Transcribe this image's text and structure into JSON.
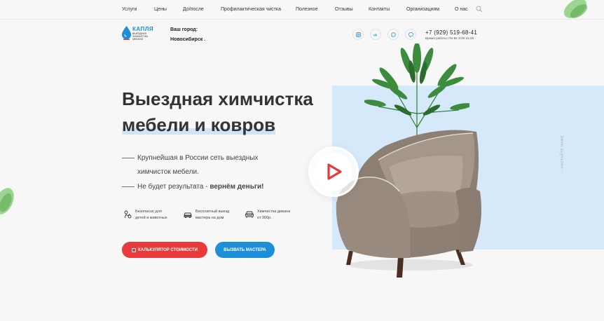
{
  "nav": {
    "items": [
      "Услуги",
      "Цены",
      "До/после",
      "Профилактическая чистка",
      "Полезное",
      "Отзывы",
      "Контакты",
      "Организациям",
      "О нас"
    ]
  },
  "logo": {
    "brand": "КАПЛЯ",
    "subtitle_lines": [
      "ВЫЕЗДНАЯ",
      "ХИМЧИСТКА",
      "МЕБЕЛИ"
    ]
  },
  "city": {
    "label": "Ваш город:",
    "value": "Новосибирск ."
  },
  "social": [
    "instagram-icon",
    "vk-icon",
    "whatsapp-icon",
    "viber-icon"
  ],
  "contacts": {
    "phone": "+7 (929) 519-68-41",
    "hours": "Время работы: Пн-Вс 9:00-21:00"
  },
  "hero": {
    "title_line1": "Выездная химчистка",
    "title_line2": "мебели и ковров",
    "lead_line1": "Крупнейшая в России сеть выездных",
    "lead_line2": "химчисток мебели.",
    "guarantee_prefix": "Не будет результата - ",
    "guarantee_bold": "вернём деньги!",
    "scroll_hint": "← ЛИСТАЙТЕ НИЖЕ"
  },
  "features": [
    {
      "icon": "child-pet-safe-icon",
      "line1": "Безопасно для",
      "line2": "детей и животных"
    },
    {
      "icon": "car-icon",
      "line1": "Бесплатный выезд",
      "line2": "мастера на дом"
    },
    {
      "icon": "sofa-icon",
      "line1": "Химчистка дивана",
      "line2": "от 900р."
    }
  ],
  "buttons": {
    "calculator": "КАЛЬКУЛЯТОР СТОИМОСТИ",
    "call_master": "ВЫЗВАТЬ МАСТЕРА"
  },
  "colors": {
    "accent_red": "#e83a3a",
    "accent_blue": "#1d8fd8",
    "panel_blue": "#d6e9fb"
  }
}
